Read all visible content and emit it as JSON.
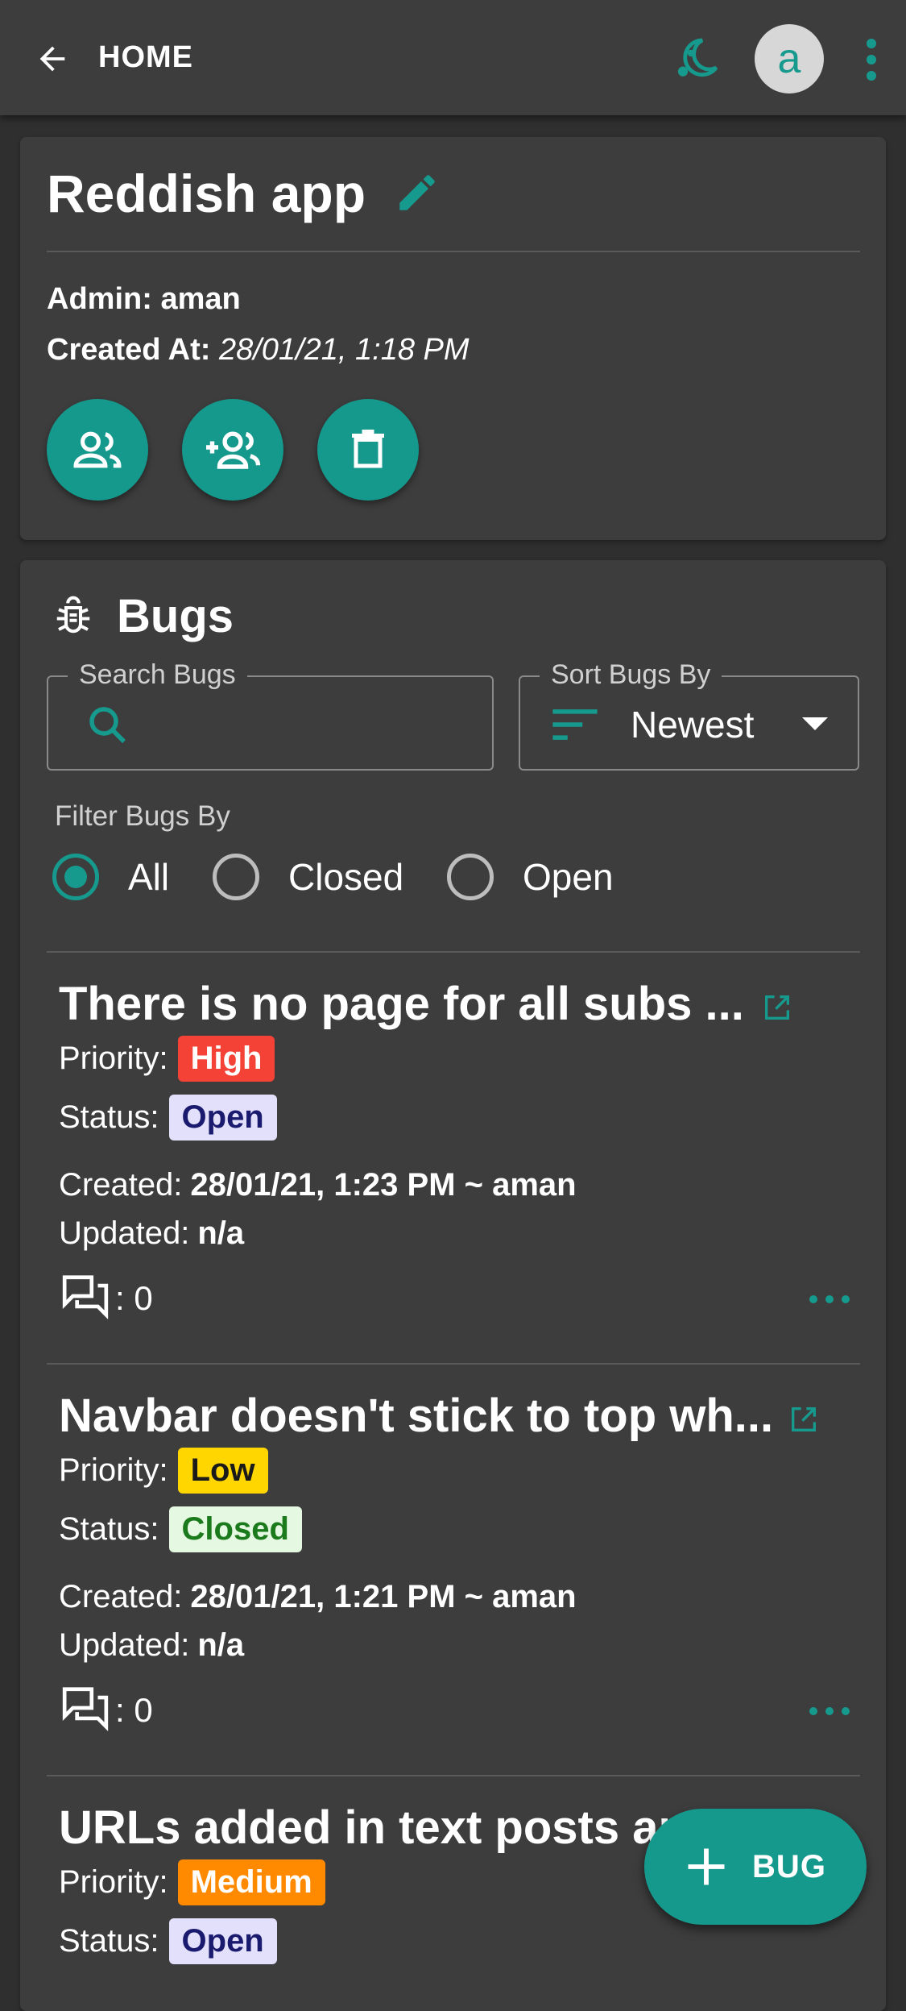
{
  "appbar": {
    "title": "HOME",
    "avatar_letter": "a"
  },
  "project": {
    "name": "Reddish app",
    "admin_label": "Admin:",
    "admin_value": "aman",
    "created_label": "Created At:",
    "created_value": "28/01/21, 1:18 PM"
  },
  "bugs": {
    "title": "Bugs",
    "search_legend": "Search Bugs",
    "search_value": "",
    "sort_legend": "Sort Bugs By",
    "sort_value": "Newest",
    "filter_label": "Filter Bugs By",
    "filters": [
      {
        "label": "All",
        "checked": true
      },
      {
        "label": "Closed",
        "checked": false
      },
      {
        "label": "Open",
        "checked": false
      }
    ],
    "priority_label": "Priority:",
    "status_label": "Status:",
    "created_label": "Created:",
    "updated_label": "Updated:",
    "items": [
      {
        "title": "There is no page for all subs ...",
        "priority": "High",
        "status": "Open",
        "created": "28/01/21, 1:23 PM ~ aman",
        "updated": "n/a",
        "comments": ": 0"
      },
      {
        "title": "Navbar doesn't stick to top wh...",
        "priority": "Low",
        "status": "Closed",
        "created": "28/01/21, 1:21 PM ~ aman",
        "updated": "n/a",
        "comments": ": 0"
      },
      {
        "title": "URLs added in text posts ar",
        "priority": "Medium",
        "status": "Open"
      }
    ]
  },
  "fab": {
    "label": "BUG"
  },
  "colors": {
    "accent": "#169a8e",
    "priority_high": "#f44336",
    "priority_low": "#ffd600",
    "priority_medium": "#ff8a00",
    "status_open_bg": "#e3e0fb",
    "status_open_text": "#1a1a6e",
    "status_closed_bg": "#e5f8e1",
    "status_closed_text": "#1b7a1b"
  }
}
